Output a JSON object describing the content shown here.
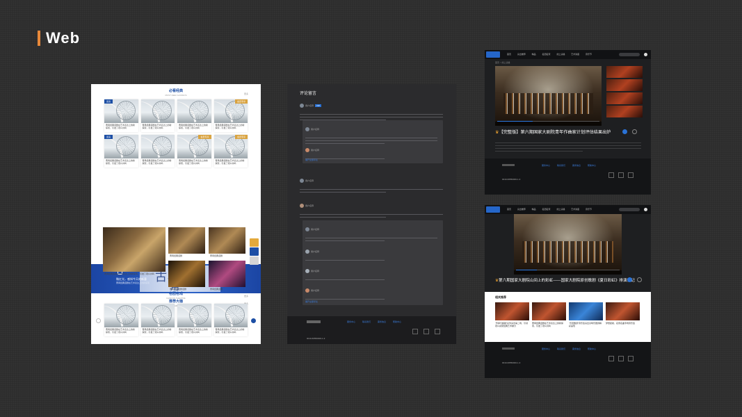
{
  "heading": "Web",
  "panel1": {
    "section1": {
      "title": "必看经典",
      "subtitle": "MUST-SEE CLASSICS",
      "more": "更多"
    },
    "cards": [
      {
        "tag": "巡演",
        "tag_style": "blue",
        "text": "曹禺经典话剧在艺术表达上的新探索，引发了观众共鸣"
      },
      {
        "tag": "",
        "tag_style": "",
        "text": "曹禺经典话剧在艺术表达上的新探索，引发了观众共鸣"
      },
      {
        "tag": "",
        "tag_style": "",
        "text": "曹禺经典话剧在艺术表达上的新探索，引发了观众共鸣"
      },
      {
        "tag": "会员专享",
        "tag_style": "gold",
        "text": "曹禺经典话剧在艺术表达上的新探索，引发了观众共鸣"
      },
      {
        "tag": "巡演",
        "tag_style": "blue",
        "text": "曹禺经典话剧在艺术表达上的新探索，引发了观众共鸣"
      },
      {
        "tag": "",
        "tag_style": "",
        "text": "曹禺经典话剧在艺术表达上的新探索，引发了观众共鸣"
      },
      {
        "tag": "会员专享",
        "tag_style": "gold",
        "text": "曹禺经典话剧在艺术表达上的新探索，引发了观众共鸣"
      },
      {
        "tag": "会员专享",
        "tag_style": "gold",
        "text": "曹禺经典话剧在艺术表达上的新探索，引发了观众共鸣"
      }
    ],
    "banner": {
      "line1": "微红光，感知今天的新意",
      "line2": "曹禺经典话剧在艺术表达上的新探索",
      "big1": "古典音乐",
      "big2": "用"
    },
    "section2": {
      "title": "推荐大咖",
      "subtitle": "THE ARTIST",
      "more": "更多"
    },
    "stage_caption_main": "曹禺经典话剧在艺术表达上的新探索，引发了观众共鸣",
    "stage_captions": [
      "曹禺经典话剧",
      "曹禺经典话剧",
      "曹禺经典话剧话剧",
      "曹禺经典话剧"
    ],
    "section3": {
      "title": "名团名戏",
      "subtitle": "FAMOUS THEATRE",
      "more": "更多"
    },
    "cards2": [
      "曹禺经典话剧在艺术表达上的新探索，引发了观众共鸣",
      "曹禺经典话剧在艺术表达上的新探索，引发了观众共鸣",
      "曹禺经典话剧在艺术表达上的新探索，引发了观众共鸣",
      "曹禺经典话剧在艺术表达上的新探索，引发了观众共鸣"
    ]
  },
  "panel2": {
    "title": "评论留言",
    "user": "用户名称",
    "vip": "VIP",
    "sample": "第六期国家大剧院青年作曲家计划正在进行，现将我的作曲作品完成了汇报演出，在舞台上全体演员的努力下顺利完成。",
    "reply": "全期的综合工作已完成，也谢谢各位老师和同学们的大力支持。",
    "actions": "点赞 · 回复",
    "more_replies": "展开全部评论"
  },
  "panel3": {
    "nav": "首页 演出推荐 精品 名团名家 线上演播 艺术讲座 音乐节",
    "crumb": "首页 > 线上演播",
    "title": "【完整版】第六期国家大剧院青年作曲家计划评估结果出炉",
    "follow": "关注",
    "share": "分享"
  },
  "panel4": {
    "title": "第六期国家大剧院山间上的彩虹——国家大剧院原创歌剧《夏日彩虹》排演侧记",
    "related_title": "相关推荐",
    "related": [
      "“传承与超越”系列演出第二场，引领观众感受经典艺术魅力",
      "曹禺经典话剧在艺术表达上的新探索，引发了观众共鸣",
      "“乐观雅颂”音乐会演出交响乐团的精彩呈现",
      "梦想起航，名家名曲专场音乐会"
    ]
  },
  "footer": {
    "phone": "0010-66550000-1-3",
    "cols": [
      "服务中心",
      "联系我们",
      "票务信息",
      "帮助中心"
    ],
    "col_items": [
      "关于我们",
      "合作伙伴",
      "常见问题",
      "隐私政策"
    ]
  },
  "colors": {
    "accent": "#e8893a",
    "brand_blue": "#1d4fa5",
    "link_blue": "#2a7ae4"
  }
}
